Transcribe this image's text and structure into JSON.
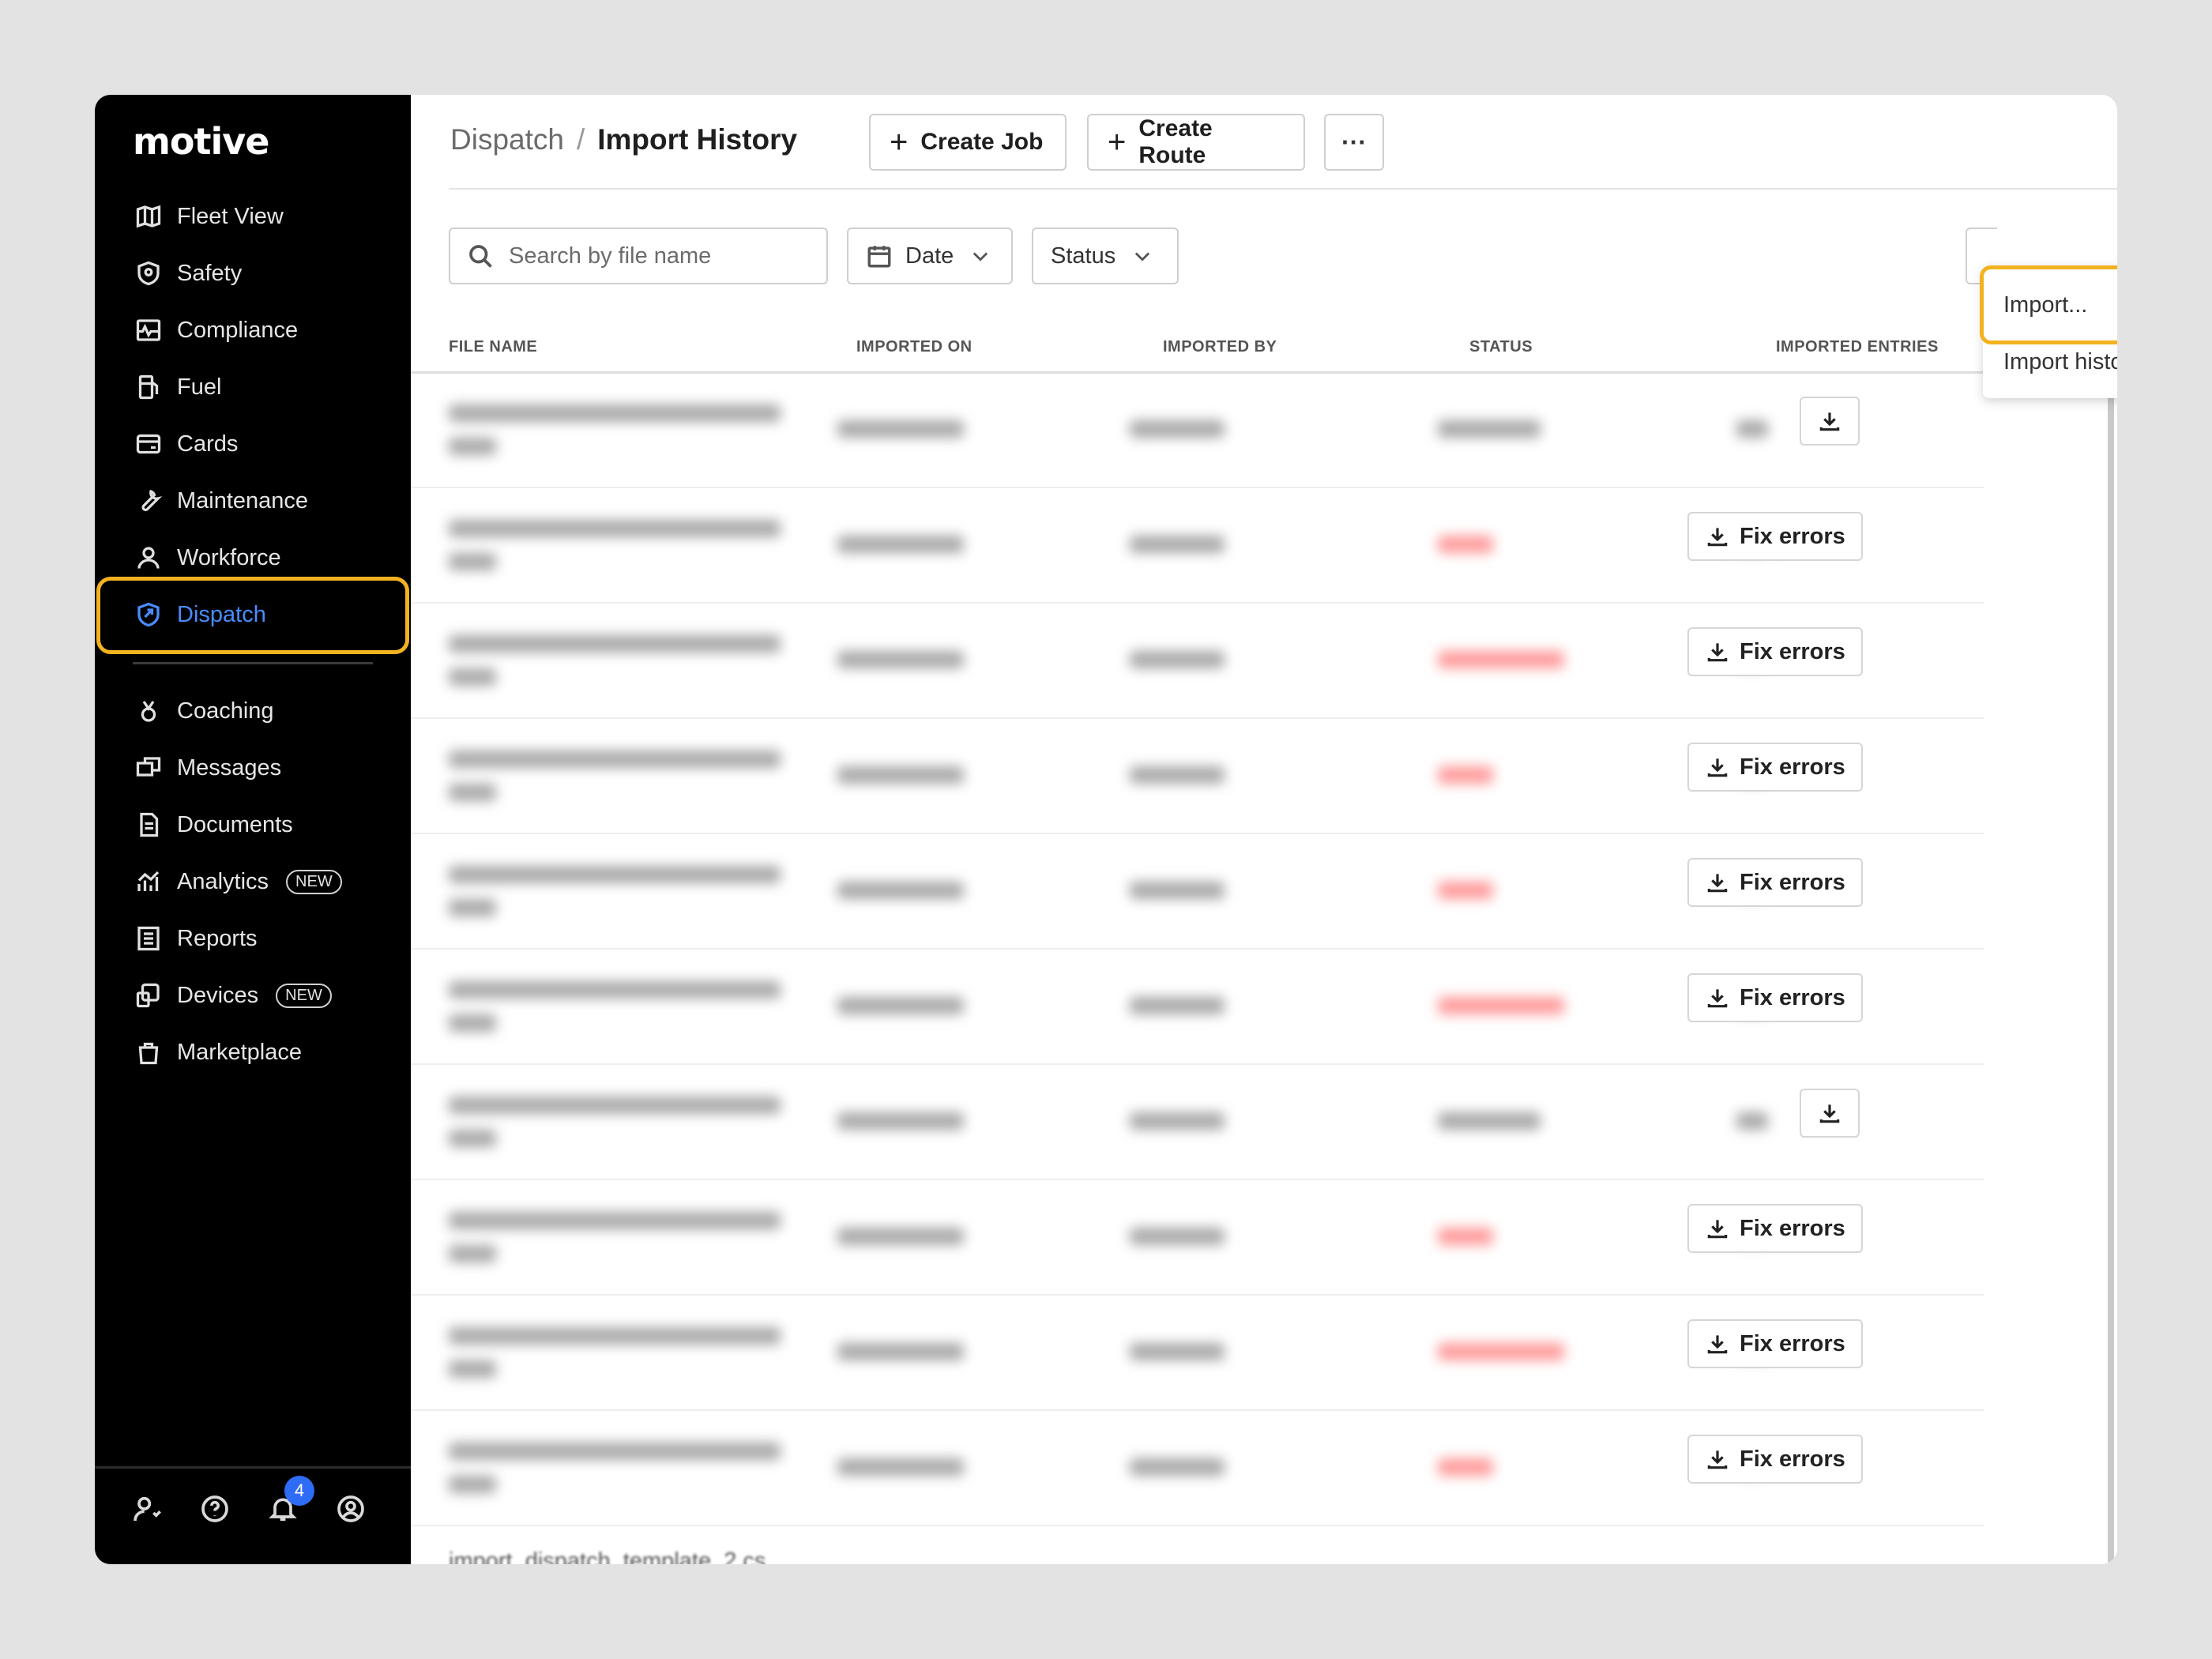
{
  "logo": "motive",
  "sidebar": {
    "items": [
      {
        "label": "Fleet View",
        "icon": "map-icon"
      },
      {
        "label": "Safety",
        "icon": "shield-icon"
      },
      {
        "label": "Compliance",
        "icon": "compliance-icon"
      },
      {
        "label": "Fuel",
        "icon": "fuel-icon"
      },
      {
        "label": "Cards",
        "icon": "card-icon"
      },
      {
        "label": "Maintenance",
        "icon": "wrench-icon"
      },
      {
        "label": "Workforce",
        "icon": "person-icon"
      },
      {
        "label": "Dispatch",
        "icon": "dispatch-icon",
        "active": true
      },
      {
        "label": "Coaching",
        "icon": "coaching-icon"
      },
      {
        "label": "Messages",
        "icon": "messages-icon"
      },
      {
        "label": "Documents",
        "icon": "document-icon"
      },
      {
        "label": "Analytics",
        "icon": "analytics-icon",
        "badge": "NEW"
      },
      {
        "label": "Reports",
        "icon": "reports-icon"
      },
      {
        "label": "Devices",
        "icon": "devices-icon",
        "badge": "NEW"
      },
      {
        "label": "Marketplace",
        "icon": "bag-icon"
      }
    ],
    "notifications_count": "4",
    "accent_color": "#4a8cff"
  },
  "header": {
    "breadcrumb_parent": "Dispatch",
    "breadcrumb_sep": "/",
    "title": "Import History",
    "create_job": "Create Job",
    "create_route": "Create Route",
    "more": "···"
  },
  "filters": {
    "search_placeholder": "Search by file name",
    "date": "Date",
    "status": "Status"
  },
  "table": {
    "columns": [
      "FILE NAME",
      "IMPORTED ON",
      "IMPORTED BY",
      "STATUS",
      "IMPORTED ENTRIES"
    ],
    "rows": [
      {
        "file": "",
        "action": "download"
      },
      {
        "file": "",
        "action": "Fix errors"
      },
      {
        "file": "",
        "action": "Fix errors"
      },
      {
        "file": "",
        "action": "Fix errors"
      },
      {
        "file": "",
        "action": "Fix errors"
      },
      {
        "file": "",
        "action": "Fix errors"
      },
      {
        "file": "",
        "action": "download"
      },
      {
        "file": "",
        "action": "Fix errors"
      },
      {
        "file": "",
        "action": "Fix errors"
      },
      {
        "file": "",
        "action": "Fix errors"
      }
    ],
    "last_row_file": "import_dispatch_template_2.cs",
    "fix_label": "Fix errors"
  },
  "dropdown": {
    "import": "Import...",
    "import_history": "Import history"
  },
  "highlight_color": "#f3b21f"
}
